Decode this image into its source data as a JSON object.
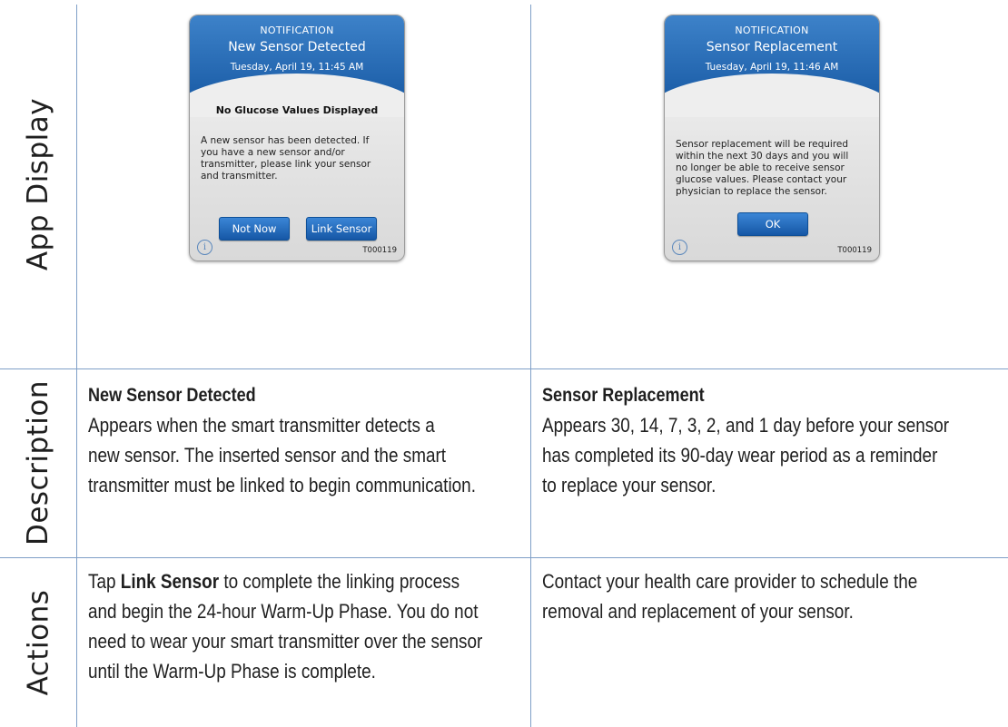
{
  "row_labels": {
    "app_display": "App Display",
    "description": "Description",
    "actions": "Actions"
  },
  "dialogs": {
    "new_sensor": {
      "tag": "NOTIFICATION",
      "title": "New Sensor Detected",
      "datetime": "Tuesday, April 19, 11:45 AM",
      "subtitle": "No Glucose Values Displayed",
      "message_lines": [
        "A new sensor has been detected. If",
        "you have a new sensor and/or",
        "transmitter, please link your sensor",
        "and transmitter."
      ],
      "buttons": {
        "not_now": "Not Now",
        "link_sensor": "Link Sensor"
      },
      "info_icon": "i",
      "code": "T000119"
    },
    "sensor_replacement": {
      "tag": "NOTIFICATION",
      "title": "Sensor Replacement",
      "datetime": "Tuesday, April 19, 11:46 AM",
      "message_lines": [
        "Sensor replacement will be required",
        "within the next 30 days and you will",
        "no longer be able to receive sensor",
        "glucose values. Please contact your",
        "physician to replace the sensor."
      ],
      "buttons": {
        "ok": "OK"
      },
      "info_icon": "i",
      "code": "T000119"
    }
  },
  "description": {
    "left": {
      "title": "New Sensor Detected",
      "lines": [
        "Appears when the smart transmitter detects a",
        "new sensor. The inserted sensor and the smart",
        "transmitter must be linked to begin communication."
      ]
    },
    "right": {
      "title": "Sensor Replacement",
      "lines": [
        "Appears 30, 14, 7, 3, 2, and 1 day before your sensor",
        "has completed its 90-day wear period as a reminder",
        "to replace your sensor."
      ]
    }
  },
  "actions": {
    "left": {
      "line1_prefix": "Tap ",
      "line1_strong": "Link Sensor",
      "line1_suffix": " to complete the linking process",
      "lines": [
        "and begin the 24-hour Warm-Up Phase. You do not",
        "need to wear your smart transmitter over the sensor",
        "until the Warm-Up Phase is complete."
      ]
    },
    "right": {
      "lines": [
        "Contact your health care provider to schedule the",
        "removal and replacement of your sensor."
      ]
    }
  },
  "colors": {
    "grid_line": "#7f9fc7",
    "dialog_header": "#2a6fb8",
    "button": "#1f67b6"
  }
}
